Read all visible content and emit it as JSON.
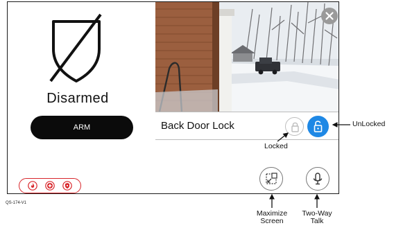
{
  "security": {
    "status": "Disarmed",
    "arm_label": "ARM",
    "emergency_icons": [
      "fire-icon",
      "medical-icon",
      "police-icon"
    ]
  },
  "camera": {
    "lock_name": "Back Door Lock",
    "close_icon": "close-icon",
    "lock_icons": {
      "locked": "lock-closed-icon",
      "unlocked": "lock-open-icon"
    },
    "unlocked_color": "#1e88e5"
  },
  "actions": {
    "maximize_icon": "maximize-icon",
    "talk_icon": "microphone-icon"
  },
  "callouts": {
    "locked": "Locked",
    "unlocked": "UnLocked",
    "maximize_line1": "Maximize",
    "maximize_line2": "Screen",
    "talk_line1": "Two-Way",
    "talk_line2": "Talk"
  },
  "figure_id": "QS-174-V1",
  "colors": {
    "emergency": "#d8262b",
    "arm_button": "#0b0b0b"
  }
}
